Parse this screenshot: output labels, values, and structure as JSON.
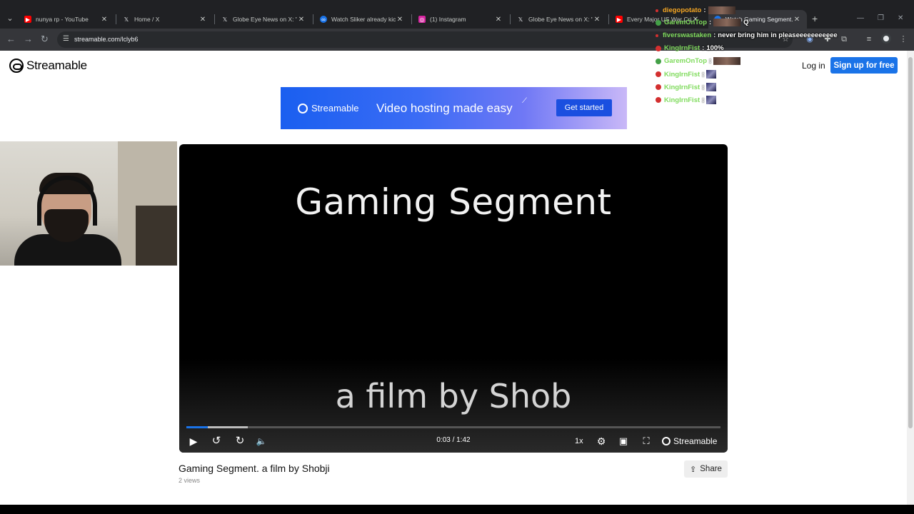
{
  "browser": {
    "tabs": [
      {
        "title": "nunya rp - YouTube",
        "favicon": "youtube-icon",
        "color": "#ff0000"
      },
      {
        "title": "Home / X",
        "favicon": "x-icon",
        "color": "#000000"
      },
      {
        "title": "Globe Eye News on X: \"BR",
        "favicon": "x-icon",
        "color": "#000000"
      },
      {
        "title": "Watch Sliker already kicke",
        "favicon": "streamable-icon",
        "color": "#1a73e8"
      },
      {
        "title": "(1) Instagram",
        "favicon": "instagram-icon",
        "color": "#d6249f"
      },
      {
        "title": "Globe Eye News on X: \"Pr",
        "favicon": "x-icon",
        "color": "#000000"
      },
      {
        "title": "Every Major US War Crim",
        "favicon": "youtube-icon",
        "color": "#ff0000"
      },
      {
        "title": "Watch Gaming Segment.",
        "favicon": "streamable-icon",
        "color": "#1a73e8"
      }
    ],
    "url": "streamable.com/lclyb6"
  },
  "header": {
    "brand": "Streamable",
    "login": "Log in",
    "signup": "Sign up for free"
  },
  "banner": {
    "brand": "Streamable",
    "tagline": "Video hosting made easy",
    "cta": "Get started"
  },
  "player": {
    "title_line1": "Gaming Segment",
    "title_line2": "a film by Shob",
    "time": "0:03 / 1:42",
    "speed": "1x",
    "brand": "Streamable",
    "played_fraction": 0.04,
    "buffered_fraction": 0.115
  },
  "video": {
    "title": "Gaming Segment. a film by Shobji",
    "views": "2 views",
    "share": "Share"
  },
  "chat": [
    {
      "user": "diegopotato",
      "text": "",
      "color": "#f5a623",
      "dot": "#d32f2f",
      "emote": "wide"
    },
    {
      "user": "GaremOnTop",
      "text": "Q",
      "color": "#7fdb5c",
      "dot": "#43a047",
      "emote": "wide"
    },
    {
      "user": "fiverswastaken",
      "text": "never bring him in pleaseeeeeeeeeee",
      "color": "#7fdb5c",
      "dot": "#d32f2f",
      "emote": ""
    },
    {
      "user": "KingIrnFist",
      "text": "100%",
      "color": "#7fdb5c",
      "dot": "#d32f2f",
      "emote": ""
    },
    {
      "user": "GaremOnTop",
      "text": "",
      "color": "#7fdb5c",
      "dot": "#43a047",
      "emote": "wide"
    },
    {
      "user": "KingIrnFist",
      "text": "",
      "color": "#7fdb5c",
      "dot": "#d32f2f",
      "emote": "small"
    },
    {
      "user": "KingIrnFist",
      "text": "",
      "color": "#7fdb5c",
      "dot": "#d32f2f",
      "emote": "small"
    },
    {
      "user": "KingIrnFist",
      "text": "",
      "color": "#7fdb5c",
      "dot": "#d32f2f",
      "emote": "small"
    }
  ]
}
